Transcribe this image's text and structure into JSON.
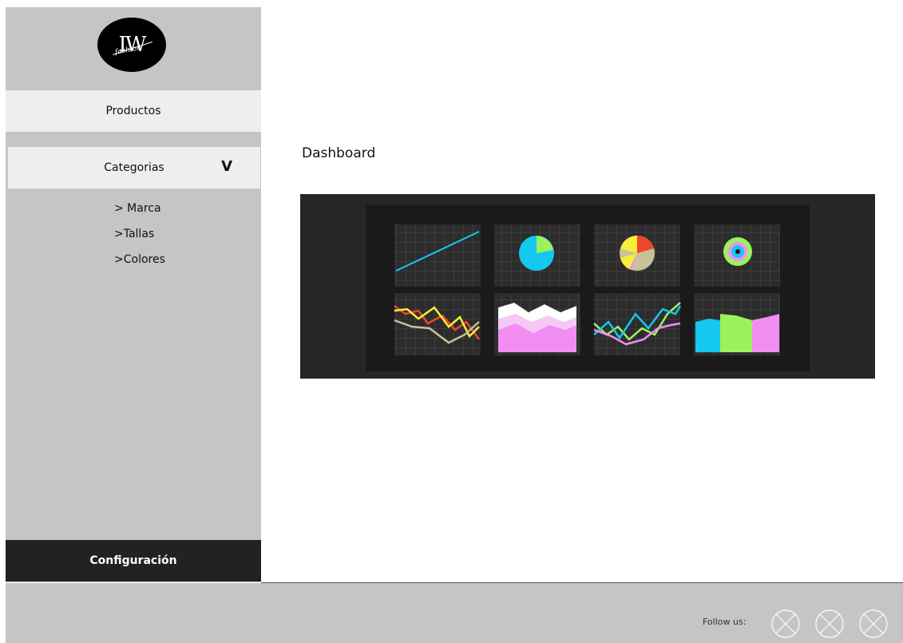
{
  "brand": {
    "logo_main": "IW",
    "logo_sub": "fashion"
  },
  "sidebar": {
    "productos": "Productos",
    "categorias": "Categorias",
    "categorias_toggle": "V",
    "subitems": [
      "> Marca",
      ">Tallas",
      ">Colores"
    ],
    "configuracion": "Configuración"
  },
  "main": {
    "title": "Dashboard"
  },
  "footer": {
    "follow_label": "Follow us:"
  },
  "colors": {
    "sidebar_bg": "#c5c5c5",
    "nav_active_bg": "#eeeeee",
    "config_bg": "#222222",
    "dashboard_bg": "#262626",
    "cyan": "#14c8f0",
    "yellow": "#f5ee3a",
    "red": "#f0452b",
    "green": "#9cf25c",
    "pink": "#f28ef2",
    "tan": "#c8c29a"
  }
}
